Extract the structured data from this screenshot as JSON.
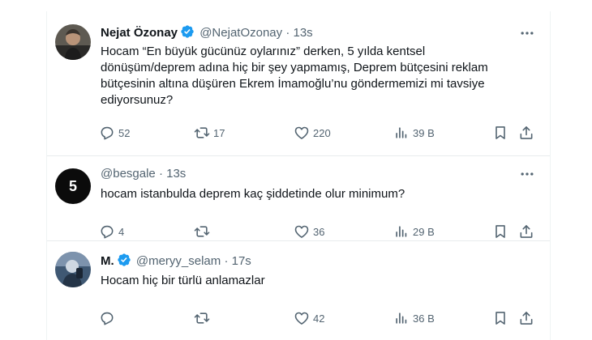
{
  "tweets": [
    {
      "name": "Nejat Özonay",
      "handle": "@NejatOzonay",
      "separator": "·",
      "time": "13s",
      "verified": true,
      "text": "Hocam “En büyük gücünüz oylarınız” derken, 5 yılda kentsel dönüşüm/deprem adına hiç bir şey yapmamış, Deprem bütçesini reklam bütçesinin altına düşüren Ekrem İmamoğlu’nu göndermemizi mi tavsiye ediyorsunuz?",
      "replies": "52",
      "retweets": "17",
      "likes": "220",
      "views": "39 B"
    },
    {
      "name": "",
      "handle": "@besgale",
      "separator": "·",
      "time": "13s",
      "verified": false,
      "avatar_letter": "5",
      "text": "hocam istanbulda deprem kaç şiddetinde olur minimum?",
      "replies": "4",
      "retweets": "",
      "likes": "36",
      "views": "29 B"
    },
    {
      "name": "M.",
      "handle": "@meryy_selam",
      "separator": "·",
      "time": "17s",
      "verified": true,
      "text": "Hocam hiç bir türlü anlamazlar",
      "replies": "",
      "retweets": "",
      "likes": "42",
      "views": "36 B"
    }
  ],
  "colors": {
    "verified": "#1d9bf0",
    "icon": "#536471",
    "text": "#0f1419",
    "divider": "#e7ebee"
  },
  "icons": [
    "verified-badge-icon",
    "more-icon",
    "reply-icon",
    "retweet-icon",
    "like-icon",
    "views-icon",
    "bookmark-icon",
    "share-icon"
  ]
}
